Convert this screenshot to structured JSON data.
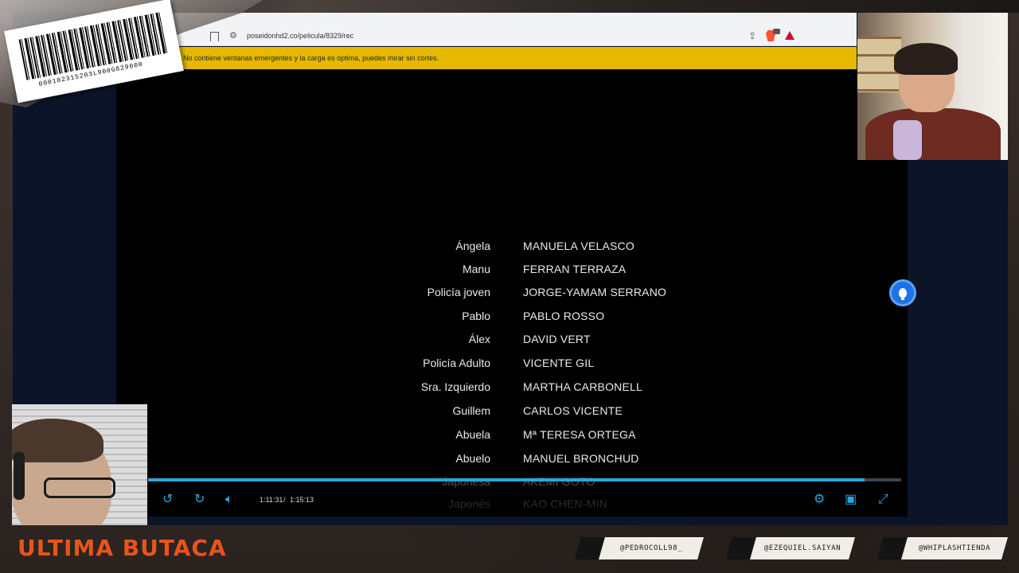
{
  "browser": {
    "url": "poseidonhd2.co/pelicula/8329/rec",
    "notice": "No contiene ventanas emergentes y la carga es optima, puedes mirar sin cortes."
  },
  "credits": [
    {
      "role": "Ángela",
      "name": "MANUELA VELASCO"
    },
    {
      "role": "Manu",
      "name": "FERRAN TERRAZA"
    },
    {
      "role": "Policía joven",
      "name": "JORGE-YAMAM SERRANO"
    },
    {
      "role": "Pablo",
      "name": "PABLO ROSSO"
    },
    {
      "role": "Álex",
      "name": "DAVID VERT"
    },
    {
      "role": "Policía Adulto",
      "name": "VICENTE GIL"
    },
    {
      "role": "Sra. Izquierdo",
      "name": "MARTHA CARBONELL"
    },
    {
      "role": "Guillem",
      "name": "CARLOS VICENTE"
    },
    {
      "role": "Abuela",
      "name": "Mª TERESA ORTEGA"
    },
    {
      "role": "Abuelo",
      "name": "MANUEL BRONCHUD"
    },
    {
      "role": "Japonesa",
      "name": "AKEMI GOTO"
    },
    {
      "role": "Japonés",
      "name": "KAO CHEN-MIN"
    }
  ],
  "player": {
    "current_time": "1:11:31",
    "separator": "/",
    "total_time": "1:15:13",
    "progress_fraction": 0.951,
    "buffered_fraction": 0.97,
    "rewind_label": "10",
    "forward_label": "10"
  },
  "barcode": {
    "digits": "000102315203L900G829000"
  },
  "overlay": {
    "title": "ULTIMA BUTACA",
    "socials": [
      "@PEDROCOLL98_",
      "@EZEQUIEL.SAIYAN",
      "@WHIPLASHTIENDA"
    ]
  },
  "colors": {
    "accent_blue": "#2aa6dd",
    "notice_yellow": "#e6b800",
    "title_orange": "#e8541b"
  }
}
